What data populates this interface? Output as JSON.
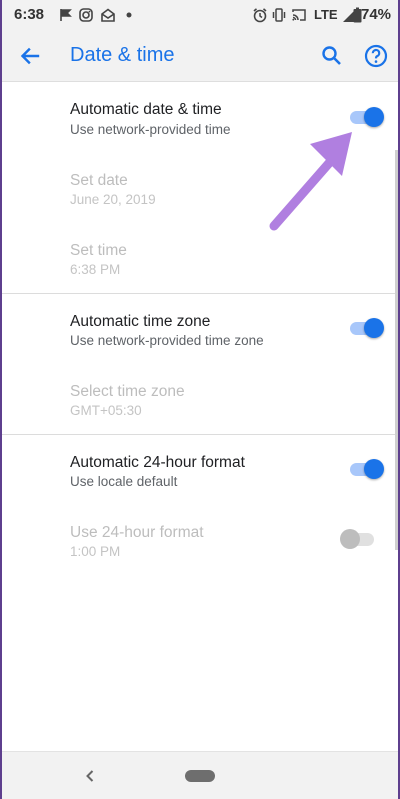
{
  "status_bar": {
    "time": "6:38",
    "network": "LTE",
    "battery_percent": "74%",
    "left_icons": [
      "location-arrow-icon",
      "instagram-icon",
      "email-icon",
      "dot-icon"
    ],
    "right_icons": [
      "alarm-icon",
      "vibrate-icon",
      "cast-icon",
      "hotspot-icon",
      "signal-icon",
      "battery-icon"
    ]
  },
  "app_bar": {
    "title": "Date & time",
    "accent_color": "#1a73e8"
  },
  "settings": [
    {
      "title": "Automatic date & time",
      "summary": "Use network-provided time",
      "enabled": true,
      "switch": "on"
    },
    {
      "title": "Set date",
      "summary": "June 20, 2019",
      "enabled": false
    },
    {
      "title": "Set time",
      "summary": "6:38 PM",
      "enabled": false
    },
    {
      "title": "Automatic time zone",
      "summary": "Use network-provided time zone",
      "enabled": true,
      "switch": "on"
    },
    {
      "title": "Select time zone",
      "summary": "GMT+05:30",
      "enabled": false
    },
    {
      "title": "Automatic 24-hour format",
      "summary": "Use locale default",
      "enabled": true,
      "switch": "on"
    },
    {
      "title": "Use 24-hour format",
      "summary": "1:00 PM",
      "enabled": false,
      "switch": "off"
    }
  ],
  "annotation": {
    "color": "#b07fe0"
  }
}
